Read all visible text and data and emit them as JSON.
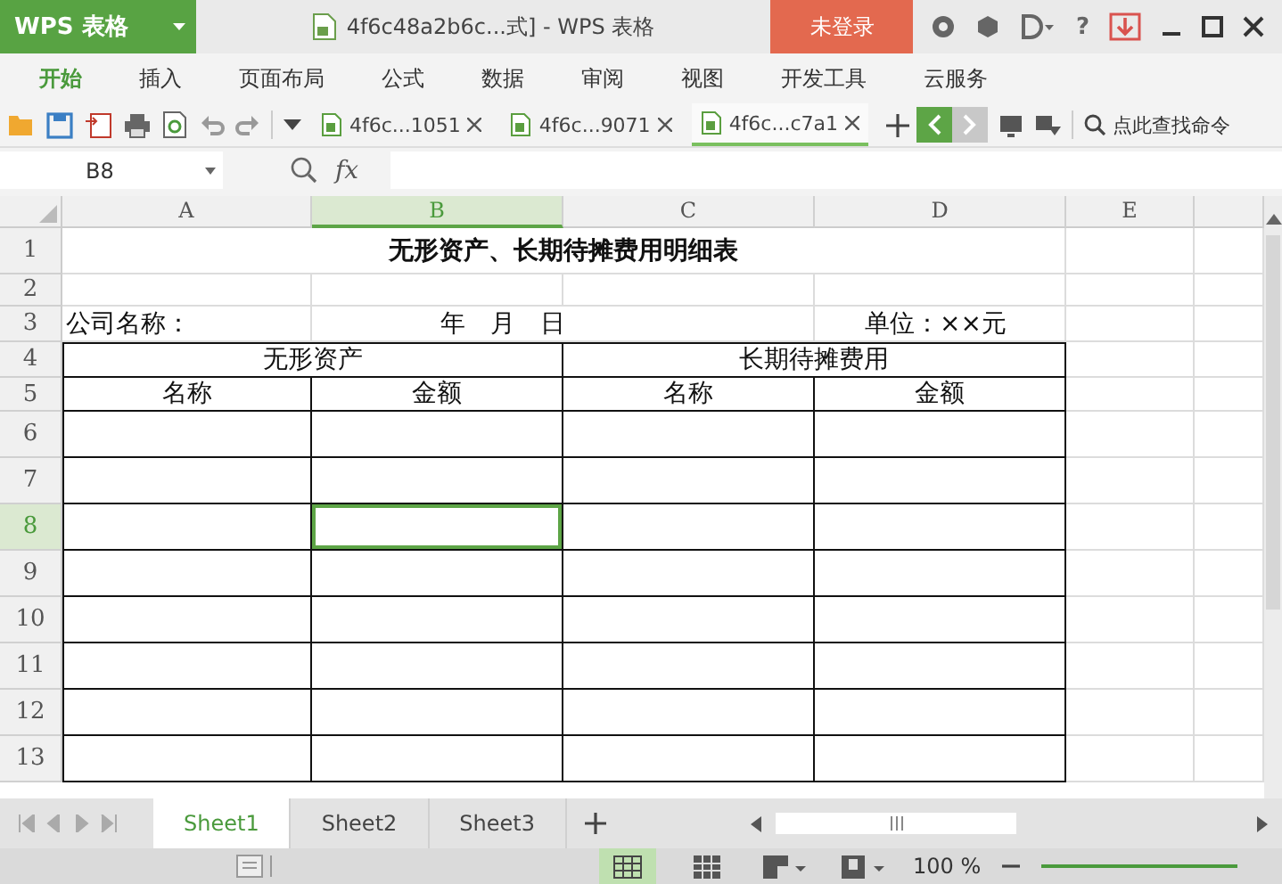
{
  "app": {
    "name": "WPS 表格"
  },
  "title_bar": {
    "document": "4f6c48a2b6c...式] - WPS 表格",
    "login": "未登录",
    "help": "?"
  },
  "menu": [
    {
      "label": "开始",
      "selected": true
    },
    {
      "label": "插入",
      "selected": false
    },
    {
      "label": "页面布局",
      "selected": false
    },
    {
      "label": "公式",
      "selected": false
    },
    {
      "label": "数据",
      "selected": false
    },
    {
      "label": "审阅",
      "selected": false
    },
    {
      "label": "视图",
      "selected": false
    },
    {
      "label": "开发工具",
      "selected": false
    },
    {
      "label": "云服务",
      "selected": false
    }
  ],
  "doc_tabs": [
    {
      "label": "4f6c...1051",
      "selected": false
    },
    {
      "label": "4f6c...9071",
      "selected": false
    },
    {
      "label": "4f6c...c7a1",
      "selected": true
    }
  ],
  "search": {
    "placeholder": "点此查找命令"
  },
  "formula_bar": {
    "name_box": "B8",
    "fx": "fx"
  },
  "columns": [
    {
      "label": "A",
      "selected": false
    },
    {
      "label": "B",
      "selected": true
    },
    {
      "label": "C",
      "selected": false
    },
    {
      "label": "D",
      "selected": false
    },
    {
      "label": "E",
      "selected": false
    }
  ],
  "rows": [
    {
      "number": "1",
      "selected": false,
      "kind": "title",
      "cells": [
        "无形资产、长期待摊费用明细表"
      ]
    },
    {
      "number": "2",
      "selected": false,
      "kind": "empty",
      "cells": []
    },
    {
      "number": "3",
      "selected": false,
      "kind": "info",
      "cells": [
        "公司名称：",
        "年　月　日",
        "单位：××元"
      ]
    },
    {
      "number": "4",
      "selected": false,
      "kind": "group",
      "cells": [
        "无形资产",
        "长期待摊费用"
      ]
    },
    {
      "number": "5",
      "selected": false,
      "kind": "header",
      "cells": [
        "名称",
        "金额",
        "名称",
        "金额"
      ]
    },
    {
      "number": "6",
      "selected": false,
      "kind": "grid",
      "cells": []
    },
    {
      "number": "7",
      "selected": false,
      "kind": "grid",
      "cells": []
    },
    {
      "number": "8",
      "selected": true,
      "kind": "grid",
      "cells": []
    },
    {
      "number": "9",
      "selected": false,
      "kind": "grid",
      "cells": []
    },
    {
      "number": "10",
      "selected": false,
      "kind": "grid",
      "cells": []
    },
    {
      "number": "11",
      "selected": false,
      "kind": "grid",
      "cells": []
    },
    {
      "number": "12",
      "selected": false,
      "kind": "grid",
      "cells": []
    },
    {
      "number": "13",
      "selected": false,
      "kind": "grid",
      "cells": []
    }
  ],
  "sheet_tabs": [
    {
      "label": "Sheet1",
      "selected": true
    },
    {
      "label": "Sheet2",
      "selected": false
    },
    {
      "label": "Sheet3",
      "selected": false
    }
  ],
  "status_bar": {
    "zoom": "100 %"
  }
}
